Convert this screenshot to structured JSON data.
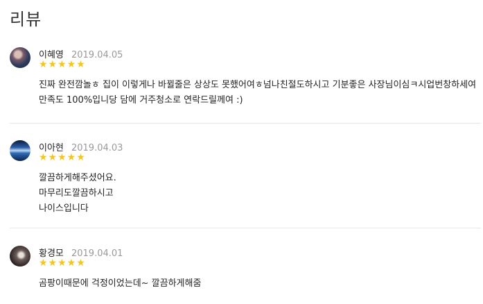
{
  "page_title": "리뷰",
  "star_char": "★★★★★",
  "reviews": [
    {
      "name": "이혜영",
      "date": "2019.04.05",
      "rating": 5,
      "text": "진짜 완전깜놀ㅎ 집이 이렇게나 바뀔줄은 상상도 못했어여ㅎ넘나친절도하시고 기분좋은 사장님이심ㅋ시업번창하세여\n만족도 100%입니당 담에 거주청소로 연락드릴께여 :)"
    },
    {
      "name": "이아현",
      "date": "2019.04.03",
      "rating": 5,
      "text": "깔끔하게해주셨어요.\n마무리도깔끔하시고\n나이스입니다"
    },
    {
      "name": "황경모",
      "date": "2019.04.01",
      "rating": 5,
      "text": "곰팡이때문에 걱정이었는데~ 깔끔하게해줌"
    }
  ],
  "colors": {
    "star": "#f5c518",
    "date": "#999999",
    "divider": "#e6e6e6"
  }
}
